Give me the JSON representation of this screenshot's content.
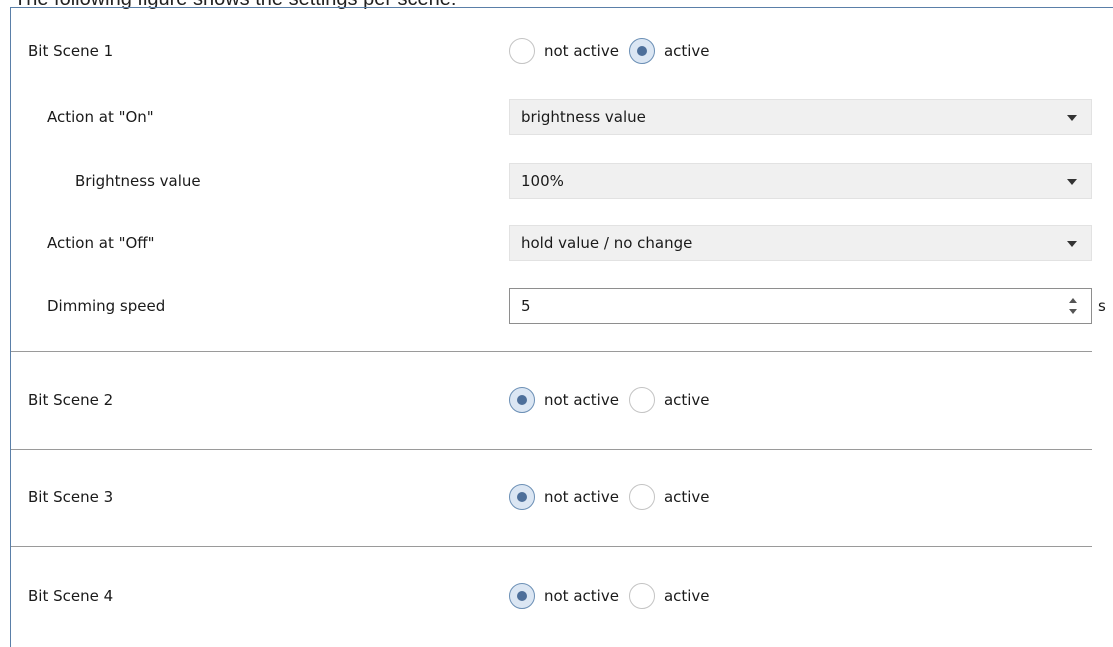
{
  "top_text": "The following figure shows the settings per scene:",
  "scene1": {
    "label": "Bit Scene 1",
    "opt_not_active": "not active",
    "opt_active": "active",
    "action_on": {
      "label": "Action at \"On\"",
      "value": "brightness value"
    },
    "brightness": {
      "label": "Brightness value",
      "value": "100%"
    },
    "action_off": {
      "label": "Action at \"Off\"",
      "value": "hold value / no change"
    },
    "dimming": {
      "label": "Dimming speed",
      "value": "5",
      "unit": "s"
    }
  },
  "scene2": {
    "label": "Bit Scene 2",
    "opt_not_active": "not active",
    "opt_active": "active"
  },
  "scene3": {
    "label": "Bit Scene 3",
    "opt_not_active": "not active",
    "opt_active": "active"
  },
  "scene4": {
    "label": "Bit Scene 4",
    "opt_not_active": "not active",
    "opt_active": "active"
  }
}
